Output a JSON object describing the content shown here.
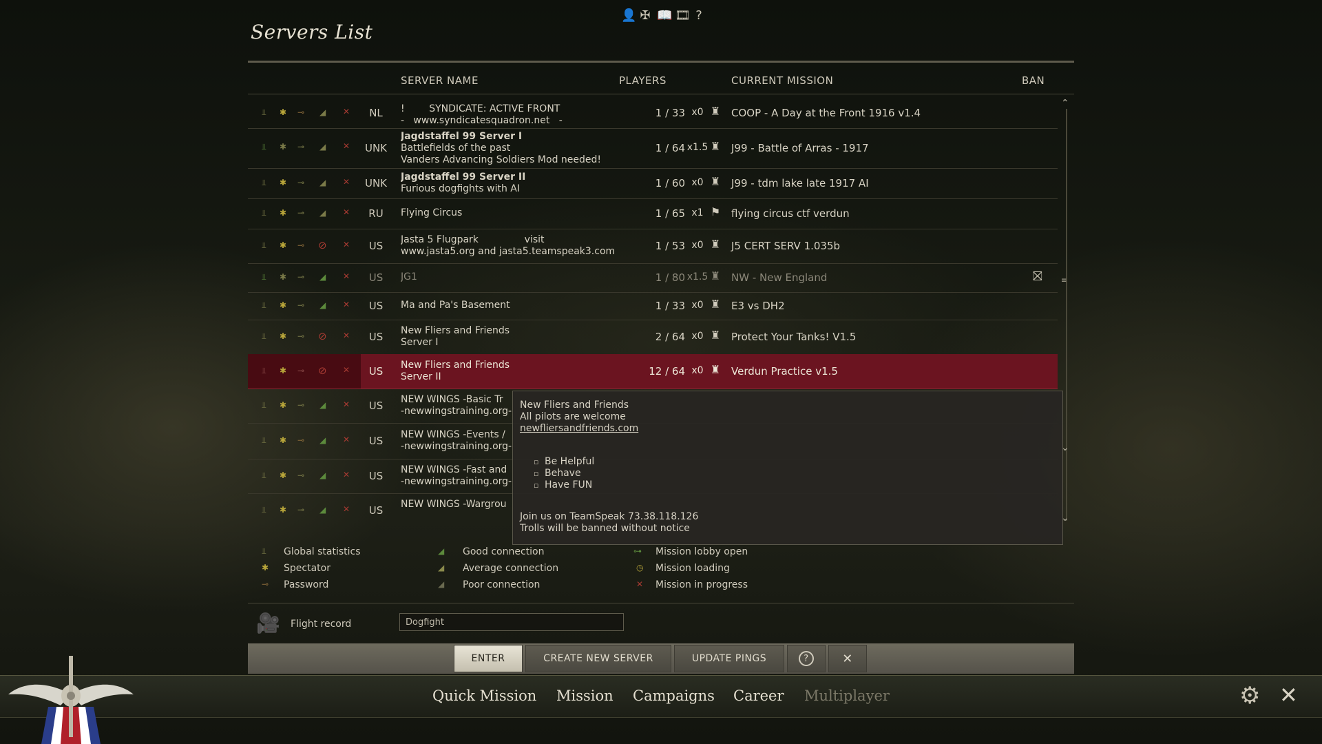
{
  "title": "Servers List",
  "top_icons": [
    {
      "name": "profile-icon",
      "glyph": "👤"
    },
    {
      "name": "medals-icon",
      "glyph": "✠"
    },
    {
      "name": "book-icon",
      "glyph": "📖"
    },
    {
      "name": "film-icon",
      "glyph": "🎞"
    },
    {
      "name": "help-icon",
      "glyph": "?"
    }
  ],
  "headers": {
    "server_name": "SERVER NAME",
    "players": "PLAYERS",
    "current_mission": "CURRENT MISSION",
    "ban": "BAN"
  },
  "servers": [
    {
      "country": "NL",
      "name_line1": "!        SYNDICATE: ACTIVE FRONT",
      "name_line2": "-   www.syndicatesquadron.net   -",
      "name_line3": "",
      "players": "1 / 33",
      "mult": "x0",
      "mission": "COOP - A Day at the Front 1916 v1.4",
      "bold": false
    },
    {
      "country": "UNK",
      "name_line1": "Jagdstaffel 99 Server I",
      "name_line2": "Battlefields of the past",
      "name_line3": "Vanders Advancing Soldiers Mod needed!",
      "players": "1 / 64",
      "mult": "x1.5",
      "mission": "J99 - Battle of Arras - 1917",
      "bold": true
    },
    {
      "country": "UNK",
      "name_line1": "Jagdstaffel 99 Server II",
      "name_line2": "Furious dogfights with AI",
      "name_line3": "",
      "players": "1 / 60",
      "mult": "x0",
      "mission": "J99 - tdm lake late 1917 AI",
      "bold": true
    },
    {
      "country": "RU",
      "name_line1": "Flying Circus",
      "name_line2": "",
      "name_line3": "",
      "players": "1 / 65",
      "mult": "x1",
      "mission": "flying circus ctf verdun",
      "bold": false
    },
    {
      "country": "US",
      "name_line1": "Jasta 5 Flugpark               visit",
      "name_line2": "www.jasta5.org and jasta5.teamspeak3.com",
      "name_line3": "",
      "players": "1 / 53",
      "mult": "x0",
      "mission": "J5 CERT SERV 1.035b",
      "bold": false
    },
    {
      "country": "US",
      "name_line1": "JG1",
      "name_line2": "",
      "name_line3": "",
      "players": "1 / 80",
      "mult": "x1.5",
      "mission": "NW - New England",
      "bold": false
    },
    {
      "country": "US",
      "name_line1": "Ma and Pa's Basement",
      "name_line2": "",
      "name_line3": "",
      "players": "1 / 33",
      "mult": "x0",
      "mission": "E3 vs DH2",
      "bold": false
    },
    {
      "country": "US",
      "name_line1": "New Fliers and Friends",
      "name_line2": "Server I",
      "name_line3": "",
      "players": "2 / 64",
      "mult": "x0",
      "mission": "Protect Your Tanks! V1.5",
      "bold": false
    },
    {
      "country": "US",
      "name_line1": "New Fliers and Friends",
      "name_line2": "Server II",
      "name_line3": "",
      "players": "12 / 64",
      "mult": "x0",
      "mission": "Verdun Practice v1.5",
      "bold": false
    },
    {
      "country": "US",
      "name_line1": "NEW WINGS -Basic Tr",
      "name_line2": "-newwingstraining.org-",
      "name_line3": "",
      "players": "",
      "mult": "",
      "mission": "",
      "bold": false
    },
    {
      "country": "US",
      "name_line1": "NEW WINGS -Events /",
      "name_line2": "-newwingstraining.org-",
      "name_line3": "",
      "players": "",
      "mult": "",
      "mission": "",
      "bold": false
    },
    {
      "country": "US",
      "name_line1": "NEW WINGS -Fast and",
      "name_line2": "-newwingstraining.org-",
      "name_line3": "",
      "players": "",
      "mult": "",
      "mission": "",
      "bold": false
    },
    {
      "country": "US",
      "name_line1": "NEW WINGS -Wargrou",
      "name_line2": "",
      "name_line3": "",
      "players": "",
      "mult": "",
      "mission": "",
      "bold": false
    }
  ],
  "tooltip": {
    "line1": "New Fliers and Friends",
    "line2": "All pilots are welcome",
    "link": "newfliersandfriends.com",
    "bullets": [
      "Be Helpful",
      "Behave",
      "Have FUN"
    ],
    "line3": "Join us on TeamSpeak 73.38.118.126",
    "line4": "Trolls will be banned without notice"
  },
  "legend": {
    "global_statistics": "Global statistics",
    "spectator": "Spectator",
    "password": "Password",
    "good_connection": "Good connection",
    "average_connection": "Average connection",
    "poor_connection": "Poor connection",
    "mission_lobby_open": "Mission lobby open",
    "mission_loading": "Mission loading",
    "mission_in_progress": "Mission in progress"
  },
  "flight_record": {
    "label": "Flight record",
    "value": "Dogfight"
  },
  "buttons": {
    "enter": "ENTER",
    "create": "CREATE NEW SERVER",
    "update": "UPDATE PINGS",
    "help": "?",
    "close": "✕"
  },
  "nav": {
    "quick_mission": "Quick Mission",
    "mission": "Mission",
    "campaigns": "Campaigns",
    "career": "Career",
    "multiplayer": "Multiplayer"
  },
  "colors": {
    "selected_row": "#6b1420",
    "accent": "#b9a63a",
    "background": "#1a1c14"
  }
}
